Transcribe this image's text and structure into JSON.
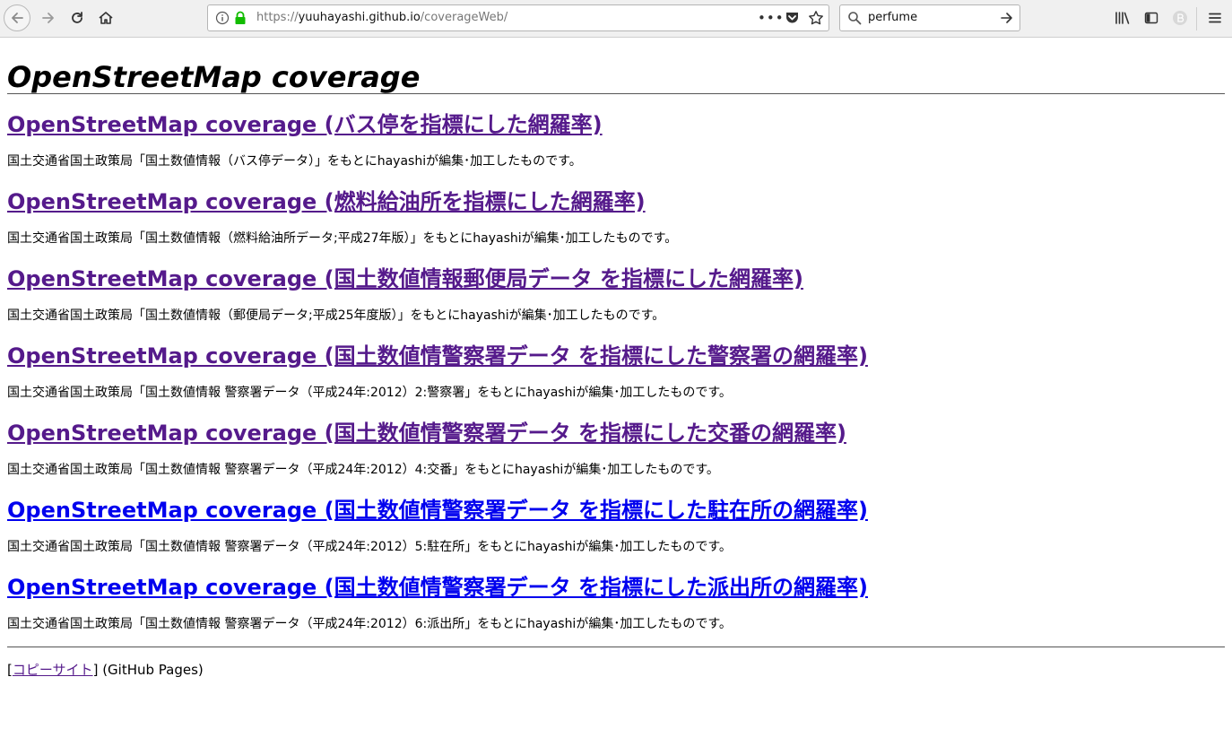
{
  "browser": {
    "url_scheme": "https://",
    "url_host": "yuuhayashi.github.io",
    "url_path": "/coverageWeb/",
    "url_more": "•••",
    "search_value": "perfume"
  },
  "page": {
    "title": "OpenStreetMap coverage",
    "sections": [
      {
        "link": "OpenStreetMap coverage (バス停を指標にした網羅率)",
        "desc": "国土交通省国土政策局「国土数値情報（バス停データ）」をもとにhayashiが編集･加工したものです。",
        "visited": true
      },
      {
        "link": "OpenStreetMap coverage (燃料給油所を指標にした網羅率)",
        "desc": "国土交通省国土政策局「国土数値情報（燃料給油所データ;平成27年版）」をもとにhayashiが編集･加工したものです。",
        "visited": true
      },
      {
        "link": "OpenStreetMap coverage (国土数値情報郵便局データ を指標にした網羅率)",
        "desc": "国土交通省国土政策局「国土数値情報（郵便局データ;平成25年度版）」をもとにhayashiが編集･加工したものです。",
        "visited": true
      },
      {
        "link": "OpenStreetMap coverage (国土数値情警察署データ を指標にした警察署の網羅率)",
        "desc": "国土交通省国土政策局「国土数値情報 警察署データ（平成24年:2012）2:警察署」をもとにhayashiが編集･加工したものです。",
        "visited": true
      },
      {
        "link": "OpenStreetMap coverage (国土数値情警察署データ を指標にした交番の網羅率)",
        "desc": "国土交通省国土政策局「国土数値情報 警察署データ（平成24年:2012）4:交番」をもとにhayashiが編集･加工したものです。",
        "visited": true
      },
      {
        "link": "OpenStreetMap coverage (国土数値情警察署データ を指標にした駐在所の網羅率)",
        "desc": "国土交通省国土政策局「国土数値情報 警察署データ（平成24年:2012）5:駐在所」をもとにhayashiが編集･加工したものです。",
        "visited": false
      },
      {
        "link": "OpenStreetMap coverage (国土数値情警察署データ を指標にした派出所の網羅率)",
        "desc": "国土交通省国土政策局「国土数値情報 警察署データ（平成24年:2012）6:派出所」をもとにhayashiが編集･加工したものです。",
        "visited": false
      }
    ],
    "footer": {
      "bracket_open": "[",
      "link": "コピーサイト",
      "bracket_close": "]",
      "suffix": " (GitHub Pages)"
    }
  },
  "colors": {
    "link_visited": "#551a8b",
    "link_unvisited": "#0000ee",
    "lock_green": "#12bc00"
  }
}
